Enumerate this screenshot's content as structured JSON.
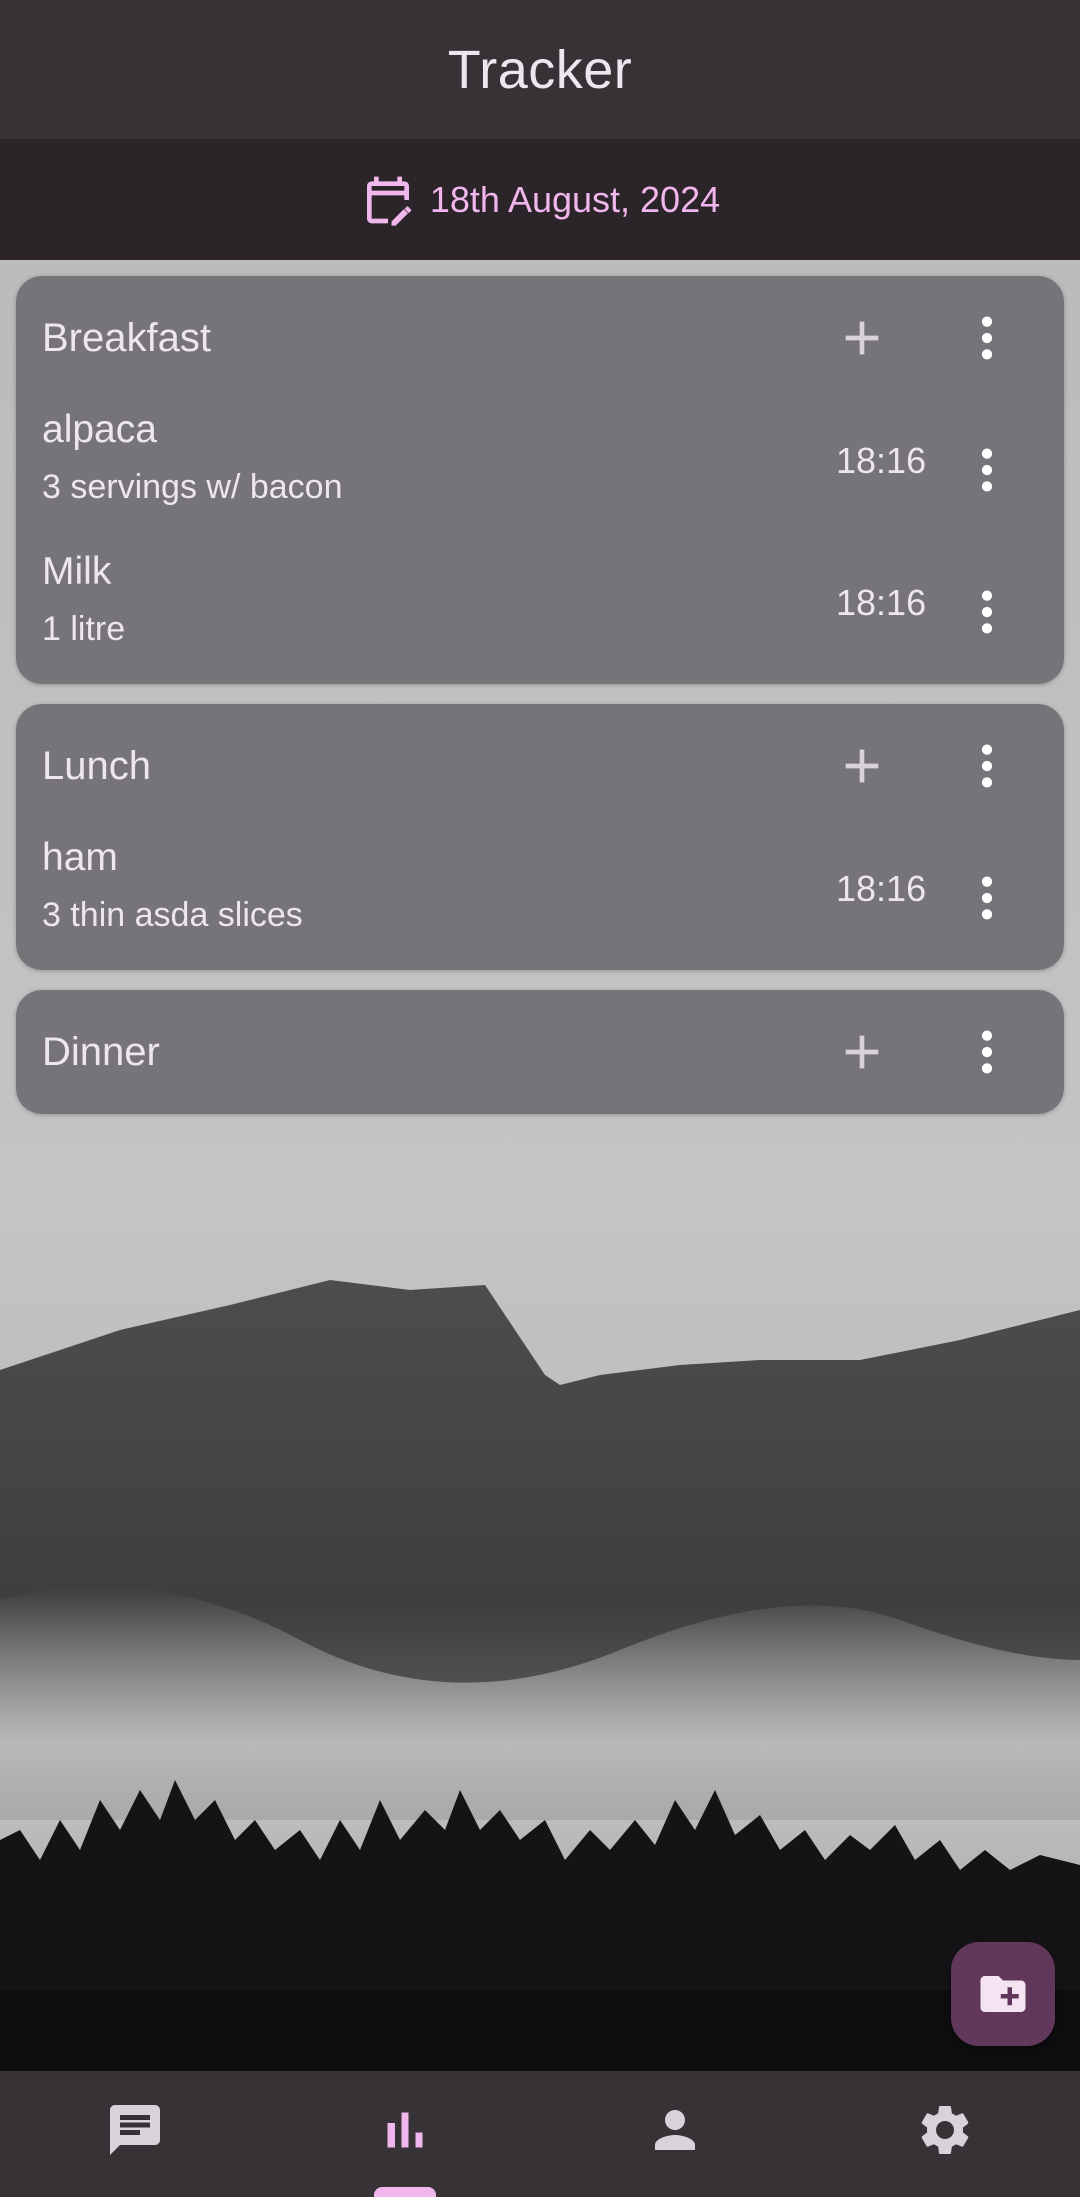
{
  "app_bar": {
    "title": "Tracker"
  },
  "date_bar": {
    "icon": "calendar-edit-icon",
    "date": "18th August, 2024"
  },
  "meals": [
    {
      "title": "Breakfast",
      "entries": [
        {
          "name": "alpaca",
          "detail": "3 servings w/ bacon",
          "time": "18:16"
        },
        {
          "name": "Milk",
          "detail": "1 litre",
          "time": "18:16"
        }
      ]
    },
    {
      "title": "Lunch",
      "entries": [
        {
          "name": "ham",
          "detail": "3 thin asda slices",
          "time": "18:16"
        }
      ]
    },
    {
      "title": "Dinner",
      "entries": []
    }
  ],
  "fab": {
    "icon": "folder-add-icon"
  },
  "bottom_nav": {
    "items": [
      {
        "icon": "chat-icon",
        "selected": false
      },
      {
        "icon": "bar-chart-icon",
        "selected": true
      },
      {
        "icon": "person-icon",
        "selected": false
      },
      {
        "icon": "gear-icon",
        "selected": false
      }
    ]
  },
  "colors": {
    "accent": "#f1b6ec",
    "app_bar": "#373236",
    "date_bar": "#2b2529",
    "card": "#706e72",
    "fab": "#61385b",
    "icon": "#d8d2da"
  }
}
